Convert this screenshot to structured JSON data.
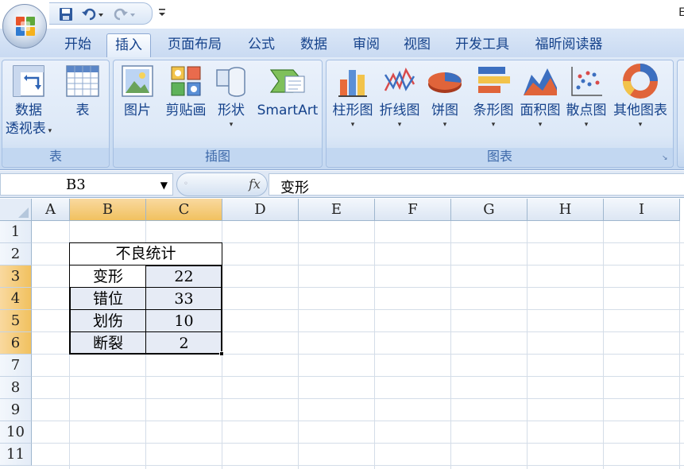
{
  "title_bar": {
    "title_fragment": "E"
  },
  "tabs": [
    {
      "label": "开始",
      "active": false
    },
    {
      "label": "插入",
      "active": true
    },
    {
      "label": "页面布局",
      "active": false
    },
    {
      "label": "公式",
      "active": false
    },
    {
      "label": "数据",
      "active": false
    },
    {
      "label": "审阅",
      "active": false
    },
    {
      "label": "视图",
      "active": false
    },
    {
      "label": "开发工具",
      "active": false
    },
    {
      "label": "福昕阅读器",
      "active": false
    }
  ],
  "ribbon": {
    "groups": [
      {
        "label": "表",
        "buttons": [
          {
            "label": "数据",
            "label2": "透视表",
            "icon": "pivot-table-icon"
          },
          {
            "label": "表",
            "icon": "table-icon"
          }
        ]
      },
      {
        "label": "插图",
        "buttons": [
          {
            "label": "图片",
            "icon": "picture-icon"
          },
          {
            "label": "剪贴画",
            "icon": "clipart-icon"
          },
          {
            "label": "形状",
            "icon": "shapes-icon"
          },
          {
            "label": "SmartArt",
            "icon": "smartart-icon"
          }
        ]
      },
      {
        "label": "图表",
        "buttons": [
          {
            "label": "柱形图",
            "icon": "column-chart-icon"
          },
          {
            "label": "折线图",
            "icon": "line-chart-icon"
          },
          {
            "label": "饼图",
            "icon": "pie-chart-icon"
          },
          {
            "label": "条形图",
            "icon": "bar-chart-icon"
          },
          {
            "label": "面积图",
            "icon": "area-chart-icon"
          },
          {
            "label": "散点图",
            "icon": "scatter-chart-icon"
          },
          {
            "label": "其他图表",
            "icon": "other-charts-icon"
          }
        ]
      }
    ]
  },
  "formula_bar": {
    "name_box": "B3",
    "fx_label": "fx",
    "formula": "变形"
  },
  "columns": [
    "A",
    "B",
    "C",
    "D",
    "E",
    "F",
    "G",
    "H",
    "I"
  ],
  "rows": [
    "1",
    "2",
    "3",
    "4",
    "5",
    "6",
    "7",
    "8",
    "9",
    "10",
    "11"
  ],
  "sheet": {
    "table_title": "不良统计",
    "rows": [
      {
        "label": "变形",
        "value": "22"
      },
      {
        "label": "错位",
        "value": "33"
      },
      {
        "label": "划伤",
        "value": "10"
      },
      {
        "label": "断裂",
        "value": "2"
      }
    ]
  },
  "colors": {
    "accent": "#15428b",
    "selected_header": "#f1c15f",
    "selection_fill": "#e6ebf5"
  }
}
